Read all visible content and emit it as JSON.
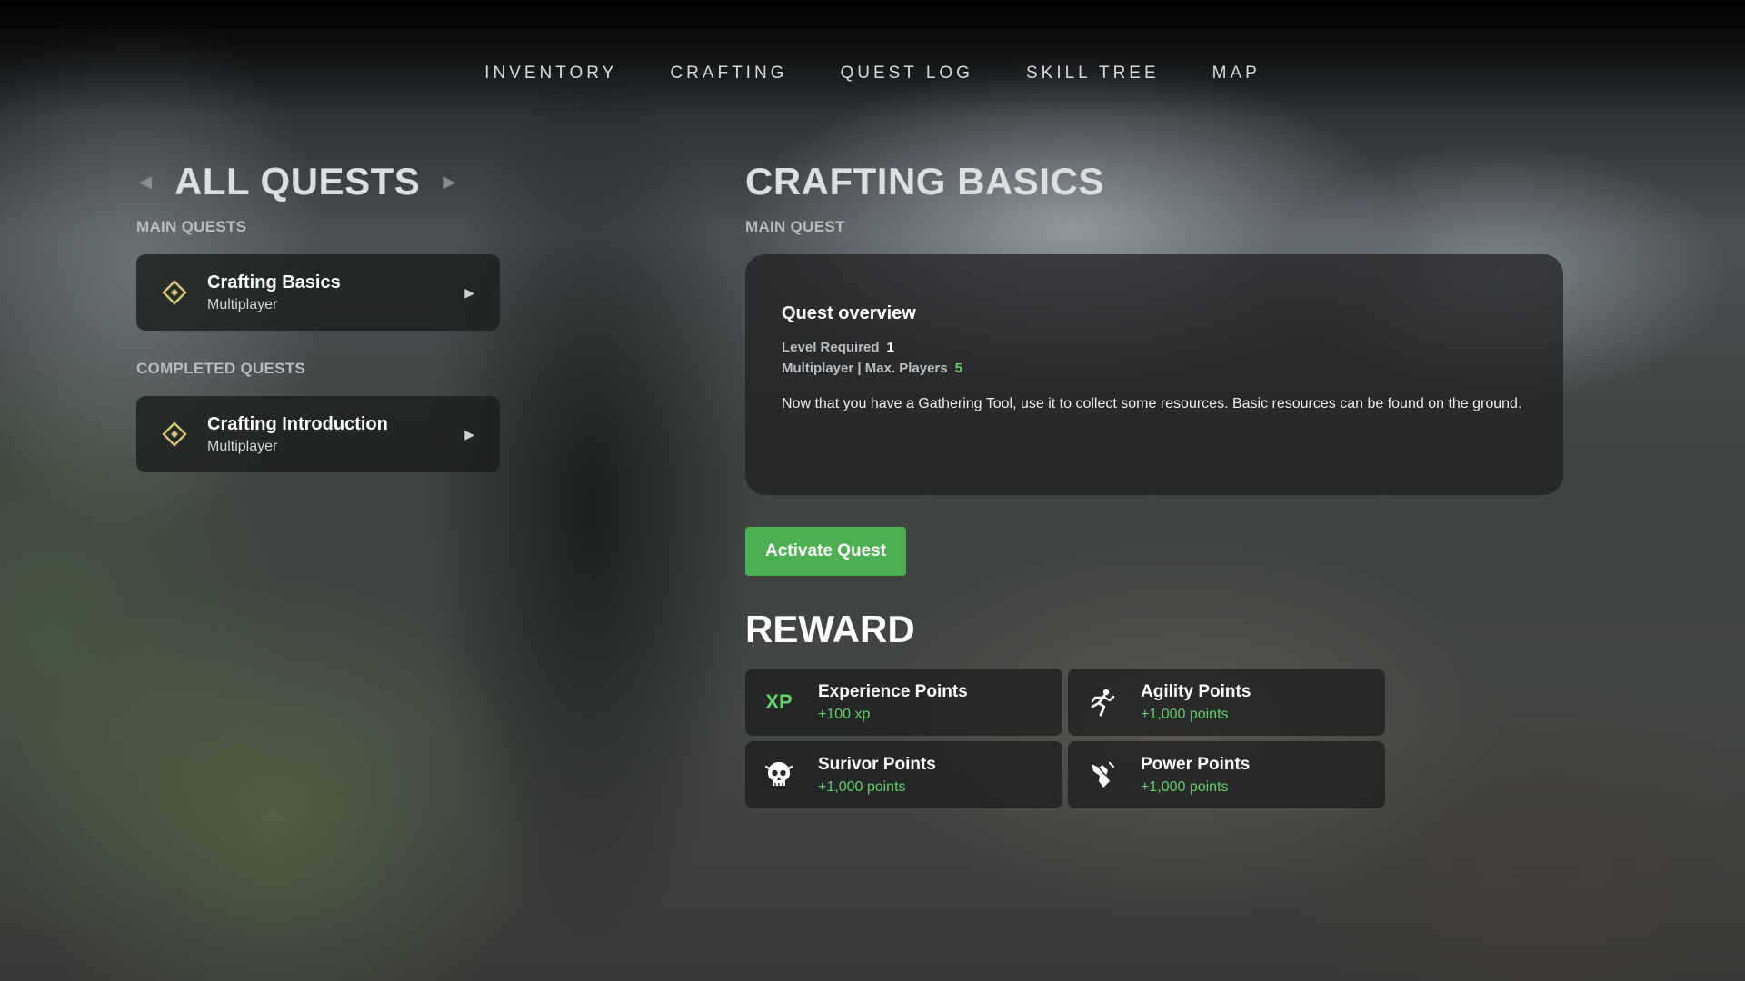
{
  "nav": {
    "items": [
      {
        "label": "INVENTORY"
      },
      {
        "label": "CRAFTING"
      },
      {
        "label": "QUEST LOG"
      },
      {
        "label": "SKILL TREE"
      },
      {
        "label": "MAP"
      }
    ]
  },
  "quest_list": {
    "title": "ALL QUESTS",
    "prev_icon": "triangle-left-icon",
    "next_icon": "triangle-right-icon",
    "main_section_label": "MAIN QUESTS",
    "main_quests": [
      {
        "name": "Crafting Basics",
        "type": "Multiplayer",
        "icon": "quest-diamond-icon"
      }
    ],
    "completed_section_label": "COMPLETED QUESTS",
    "completed_quests": [
      {
        "name": "Crafting Introduction",
        "type": "Multiplayer",
        "icon": "quest-diamond-icon"
      }
    ]
  },
  "detail": {
    "title": "CRAFTING BASICS",
    "category": "MAIN QUEST",
    "overview": {
      "heading": "Quest overview",
      "level_label": "Level Required",
      "level_value": "1",
      "players_label": "Multiplayer | Max. Players",
      "players_value": "5",
      "description": "Now that you have a Gathering Tool, use it to collect some resources. Basic resources can be found on the ground."
    },
    "activate_label": "Activate Quest"
  },
  "reward": {
    "title": "REWARD",
    "items": [
      {
        "name": "Experience Points",
        "value": "+100 xp",
        "icon": "xp-icon",
        "glyph": "XP"
      },
      {
        "name": "Agility Points",
        "value": "+1,000 points",
        "icon": "running-figure-icon"
      },
      {
        "name": "Surivor Points",
        "value": "+1,000 points",
        "icon": "skull-emblem-icon"
      },
      {
        "name": "Power Points",
        "value": "+1,000 points",
        "icon": "fist-emblem-icon"
      }
    ]
  },
  "colors": {
    "accent_green": "#4caf50",
    "value_green": "#5fd06a",
    "quest_icon_gold": "#d9c66a"
  }
}
